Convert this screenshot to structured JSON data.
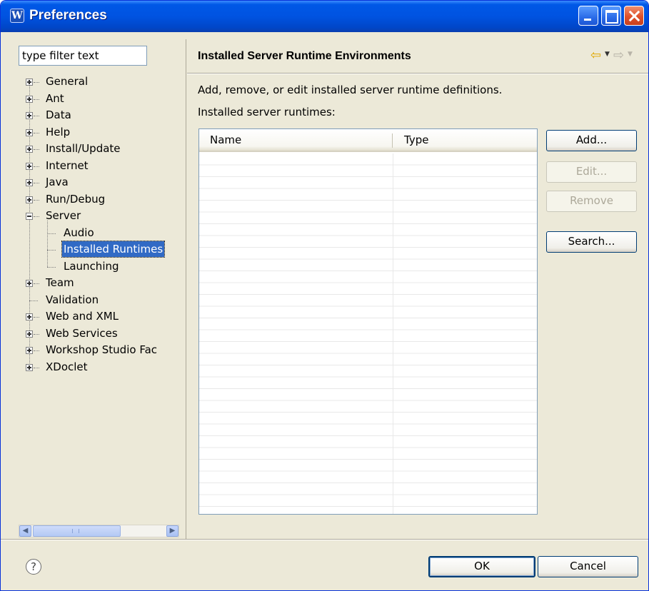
{
  "window": {
    "title": "Preferences",
    "app_icon": "W",
    "controls": [
      "minimize",
      "maximize",
      "close"
    ]
  },
  "filter": {
    "value": "type filter text"
  },
  "tree": {
    "items": [
      {
        "label": "General",
        "expander": "plus"
      },
      {
        "label": "Ant",
        "expander": "plus"
      },
      {
        "label": "Data",
        "expander": "plus"
      },
      {
        "label": "Help",
        "expander": "plus"
      },
      {
        "label": "Install/Update",
        "expander": "plus"
      },
      {
        "label": "Internet",
        "expander": "plus"
      },
      {
        "label": "Java",
        "expander": "plus"
      },
      {
        "label": "Run/Debug",
        "expander": "plus"
      },
      {
        "label": "Server",
        "expander": "minus"
      },
      {
        "label": "Audio",
        "expander": "none"
      },
      {
        "label": "Installed Runtimes",
        "expander": "none",
        "selected": true
      },
      {
        "label": "Launching",
        "expander": "none"
      },
      {
        "label": "Team",
        "expander": "plus"
      },
      {
        "label": "Validation",
        "expander": "none"
      },
      {
        "label": "Web and XML",
        "expander": "plus"
      },
      {
        "label": "Web Services",
        "expander": "plus"
      },
      {
        "label": "Workshop Studio Fac",
        "expander": "plus"
      },
      {
        "label": "XDoclet",
        "expander": "plus"
      }
    ]
  },
  "page": {
    "title": "Installed Server Runtime Environments",
    "description": "Add, remove, or edit installed server runtime definitions.",
    "table_label": "Installed server runtimes:",
    "columns": [
      "Name",
      "Type"
    ],
    "rows": []
  },
  "buttons": {
    "add": "Add...",
    "edit": "Edit...",
    "remove": "Remove",
    "search": "Search...",
    "ok": "OK",
    "cancel": "Cancel"
  },
  "icons": {
    "help": "?",
    "back": "⇦",
    "forward": "⇨",
    "dropdown": "▼",
    "scroll_left": "◀",
    "scroll_right": "▶"
  },
  "colors": {
    "titlebar": "#0054e3",
    "selection": "#316ac5",
    "dialog_bg": "#ece9d8"
  }
}
